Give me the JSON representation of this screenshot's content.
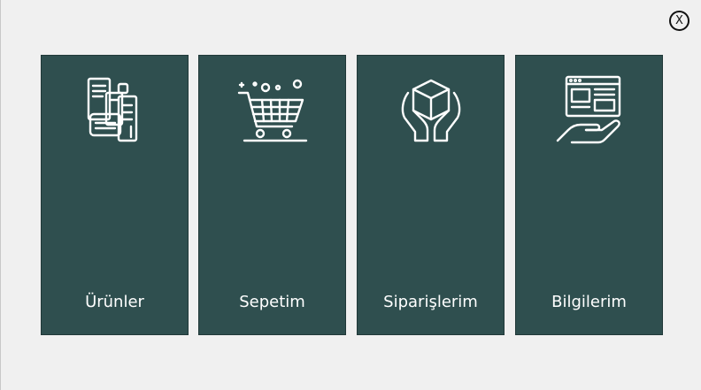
{
  "close_button": {
    "label": "X"
  },
  "tiles": [
    {
      "label": "Ürünler",
      "icon": "products-icon"
    },
    {
      "label": "Sepetim",
      "icon": "shopping-cart-icon"
    },
    {
      "label": "Siparişlerim",
      "icon": "box-in-hands-icon"
    },
    {
      "label": "Bilgilerim",
      "icon": "webpage-on-hand-icon"
    }
  ],
  "colors": {
    "background": "#f0f0f0",
    "tile": "#2f4f4f",
    "tile_text": "#ffffff"
  }
}
